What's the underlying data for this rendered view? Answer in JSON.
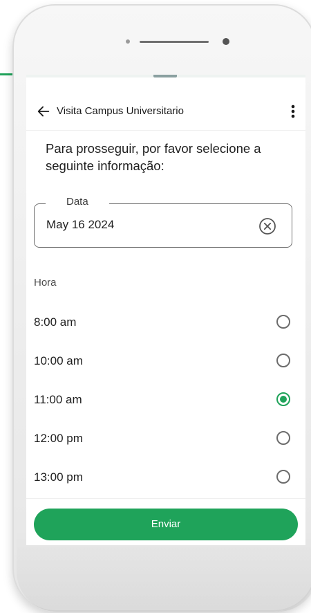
{
  "app": {
    "title": "Visita Campus Universitario",
    "back_icon": "arrow-left-icon",
    "menu_icon": "more-vertical-icon"
  },
  "form": {
    "prompt": "Para prosseguir, por favor selecione a seguinte informação:",
    "date_label": "Data",
    "date_value": "May 16 2024",
    "clear_icon": "clear-circle-icon",
    "time_label": "Hora",
    "time_options": [
      {
        "label": "8:00 am",
        "selected": false
      },
      {
        "label": "10:00 am",
        "selected": false
      },
      {
        "label": "11:00 am",
        "selected": true
      },
      {
        "label": "12:00 pm",
        "selected": false
      },
      {
        "label": "13:00 pm",
        "selected": false
      }
    ],
    "submit_label": "Enviar"
  },
  "colors": {
    "accent": "#1fa35a",
    "text": "#1f1f1f",
    "border": "#6f6f6f"
  }
}
